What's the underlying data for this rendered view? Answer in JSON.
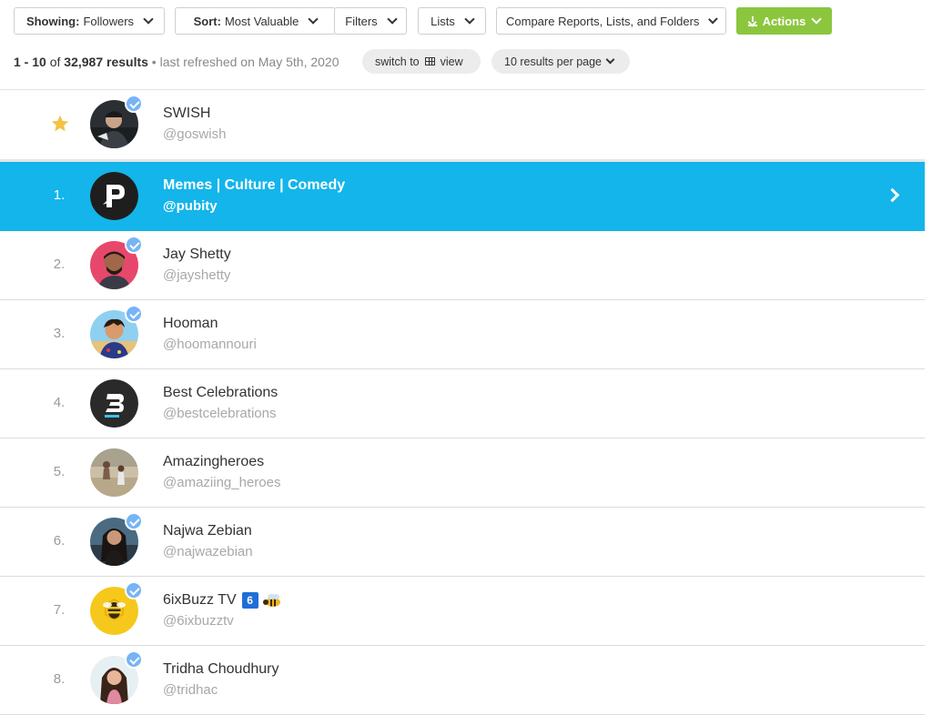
{
  "toolbar": {
    "showing_label": "Showing:",
    "showing_value": "Followers",
    "sort_label": "Sort:",
    "sort_value": "Most Valuable",
    "filters_label": "Filters",
    "lists_label": "Lists",
    "compare_label": "Compare Reports, Lists, and Folders",
    "actions_label": "Actions"
  },
  "subbar": {
    "range": "1 - 10",
    "of": "of",
    "total": "32,987 results",
    "separator": "•",
    "refreshed": "last refreshed on May 5th, 2020",
    "switch_prefix": "switch to",
    "switch_suffix": "view",
    "per_page": "10 results per page"
  },
  "colors": {
    "accent_blue": "#13b5ea",
    "actions_green": "#8cc63f",
    "verified_blue": "#77b4f5",
    "star_gold": "#f5c243"
  },
  "rows": [
    {
      "rank": "",
      "starred": true,
      "name": "SWISH",
      "handle": "@goswish",
      "verified": true
    },
    {
      "rank": "1.",
      "name": "Memes | Culture | Comedy",
      "handle": "@pubity",
      "verified": false,
      "selected": true
    },
    {
      "rank": "2.",
      "name": "Jay Shetty",
      "handle": "@jayshetty",
      "verified": true
    },
    {
      "rank": "3.",
      "name": "Hooman",
      "handle": "@hoomannouri",
      "verified": true
    },
    {
      "rank": "4.",
      "name": "Best Celebrations",
      "handle": "@bestcelebrations",
      "verified": false
    },
    {
      "rank": "5.",
      "name": "Amazingheroes",
      "handle": "@amaziing_heroes",
      "verified": false
    },
    {
      "rank": "6.",
      "name": "Najwa Zebian",
      "handle": "@najwazebian",
      "verified": true
    },
    {
      "rank": "7.",
      "name": "6ixBuzz TV",
      "name_emoji_six": "6",
      "handle": "@6ixbuzztv",
      "verified": true
    },
    {
      "rank": "8.",
      "name": "Tridha Choudhury",
      "handle": "@tridhac",
      "verified": true
    }
  ]
}
